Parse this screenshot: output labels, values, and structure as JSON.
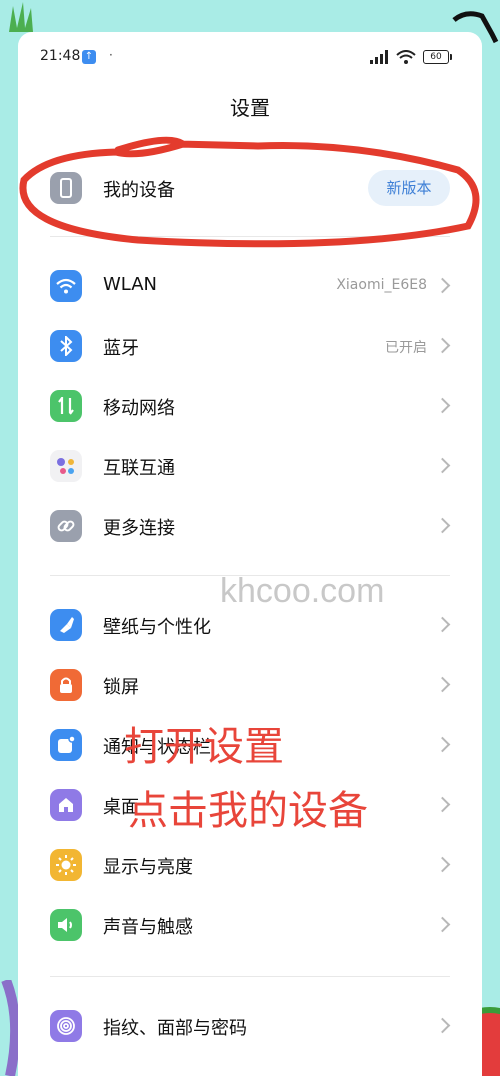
{
  "status_bar": {
    "time": "21:48",
    "battery": "60"
  },
  "header": {
    "title": "设置"
  },
  "device": {
    "label": "我的设备",
    "badge": "新版本"
  },
  "connect": [
    {
      "label": "WLAN",
      "value": "Xiaomi_E6E8"
    },
    {
      "label": "蓝牙",
      "value": "已开启"
    },
    {
      "label": "移动网络",
      "value": ""
    },
    {
      "label": "互联互通",
      "value": ""
    },
    {
      "label": "更多连接",
      "value": ""
    }
  ],
  "personal": [
    {
      "label": "壁纸与个性化"
    },
    {
      "label": "锁屏"
    },
    {
      "label": "通知与状态栏"
    },
    {
      "label": "桌面"
    },
    {
      "label": "显示与亮度"
    },
    {
      "label": "声音与触感"
    }
  ],
  "security": [
    {
      "label": "指纹、面部与密码"
    }
  ],
  "overlay": {
    "watermark": "khcoo.com",
    "line1": "打开设置",
    "line2": "点击我的设备"
  },
  "colors": {
    "background": "#a9ece6",
    "annotation": "#e8453a",
    "accent_blue": "#3d7fd6"
  }
}
